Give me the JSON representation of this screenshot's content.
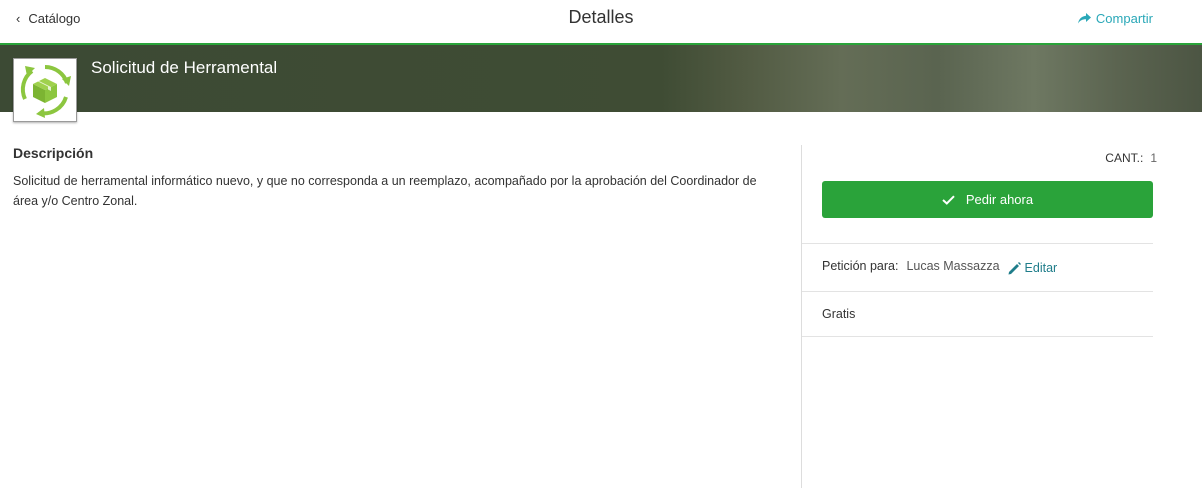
{
  "header": {
    "back_label": "Catálogo",
    "title": "Detalles",
    "share_label": "Compartir"
  },
  "item": {
    "title": "Solicitud de Herramental",
    "icon": "recycle-box-icon"
  },
  "description": {
    "heading": "Descripción",
    "text": "Solicitud de herramental informático nuevo, y que no corresponda a un reemplazo, acompañado por la aprobación del Coordinador de área y/o Centro Zonal."
  },
  "order": {
    "qty_label": "CANT.:",
    "qty_value": "1",
    "button_label": "Pedir ahora",
    "request_for_label": "Petición para:",
    "request_for_name": "Lucas Massazza",
    "edit_label": "Editar",
    "price": "Gratis"
  },
  "colors": {
    "accent_green": "#2aa33a",
    "link_teal": "#2aa8b8",
    "banner_dark": "#3c4a34",
    "icon_green": "#8cc63f"
  }
}
